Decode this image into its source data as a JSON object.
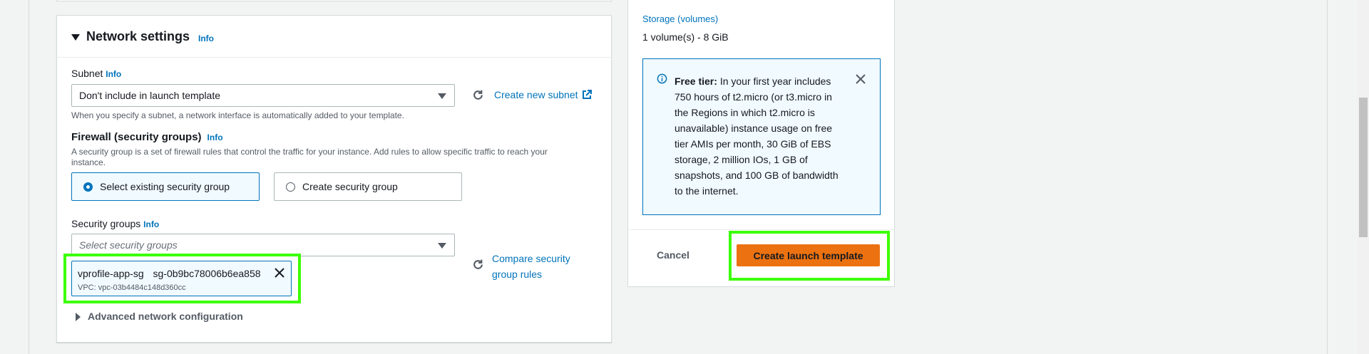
{
  "network": {
    "title": "Network settings",
    "info": "Info",
    "subnet": {
      "label": "Subnet",
      "info": "Info",
      "value": "Don't include in launch template",
      "create_link": "Create new subnet",
      "hint": "When you specify a subnet, a network interface is automatically added to your template."
    },
    "firewall": {
      "title": "Firewall (security groups)",
      "info": "Info",
      "desc_line1": "A security group is a set of firewall rules that control the traffic for your instance. Add rules to allow specific traffic to reach your",
      "desc_line2": "instance.",
      "option_existing": "Select existing security group",
      "option_create": "Create security group"
    },
    "security_groups": {
      "label": "Security groups",
      "info": "Info",
      "placeholder": "Select security groups",
      "token_name": "vprofile-app-sg",
      "token_id": "sg-0b9bc78006b6ea858",
      "token_vpc": "VPC: vpc-03b4484c148d360cc",
      "compare_line1": "Compare security",
      "compare_line2": "group rules"
    },
    "advanced": "Advanced network configuration"
  },
  "summary": {
    "storage_link": "Storage (volumes)",
    "storage_value": "1 volume(s) - 8 GiB",
    "free_tier": {
      "bold": "Free tier:",
      "lines": [
        "In your first year includes",
        "750 hours of t2.micro (or t3.micro in",
        "the Regions in which t2.micro is",
        "unavailable) instance usage on free",
        "tier AMIs per month, 30 GiB of EBS",
        "storage, 2 million IOs, 1 GB of",
        "snapshots, and 100 GB of bandwidth",
        "to the internet."
      ]
    },
    "cancel": "Cancel",
    "create": "Create launch template"
  },
  "colors": {
    "accent": "#0073bb",
    "primary_button": "#ec7211",
    "highlight": "#3cff00"
  },
  "icons": [
    "caret-down-icon",
    "refresh-icon",
    "external-link-icon",
    "close-icon",
    "info-circle-icon",
    "caret-right-icon"
  ]
}
